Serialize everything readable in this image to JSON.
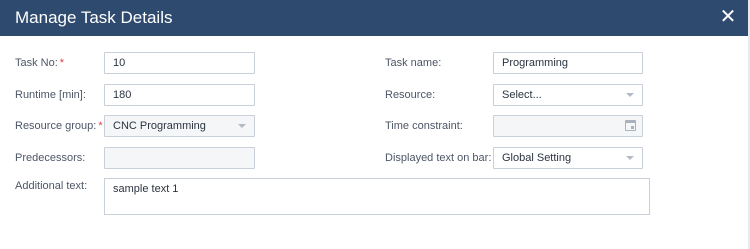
{
  "dialog": {
    "title": "Manage Task Details",
    "close_symbol": "✕"
  },
  "fields": {
    "task_no": {
      "label": "Task No:",
      "required": "*",
      "value": "10"
    },
    "runtime": {
      "label": "Runtime [min]:",
      "value": "180"
    },
    "resource_group": {
      "label": "Resource group:",
      "required": "*",
      "value": "CNC Programming"
    },
    "predecessors": {
      "label": "Predecessors:",
      "value": ""
    },
    "additional_text": {
      "label": "Additional text:",
      "value": "sample text 1"
    },
    "task_name": {
      "label": "Task name:",
      "value": "Programming"
    },
    "resource": {
      "label": "Resource:",
      "value": "Select..."
    },
    "time_constraint": {
      "label": "Time constraint:",
      "value": ""
    },
    "displayed_text": {
      "label": "Displayed text on bar:",
      "value": "Global Setting"
    }
  },
  "colors": {
    "titlebar": "#2e4a6e",
    "required": "#d9434b"
  },
  "icons": {
    "close": "close-icon",
    "dropdown": "chevron-down-icon",
    "calendar": "calendar-icon"
  }
}
